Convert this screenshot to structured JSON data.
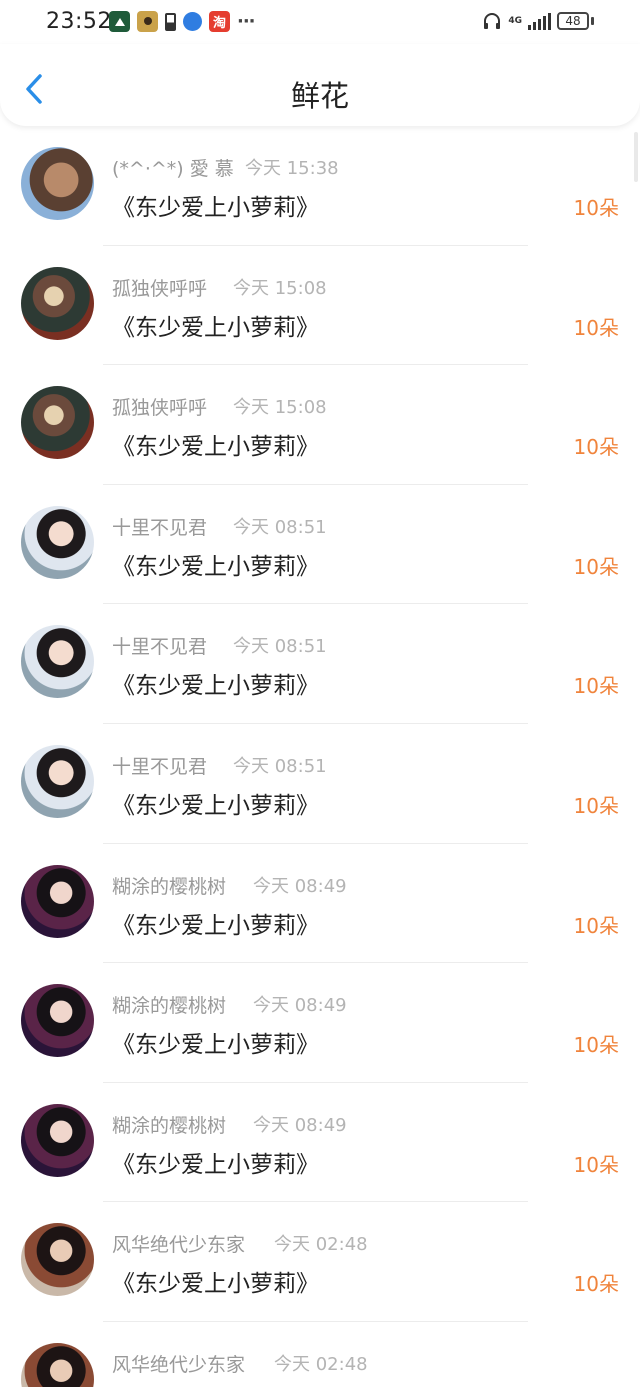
{
  "status_bar": {
    "time": "23:52",
    "notification_icon_labels": [
      "淘"
    ],
    "more": "···",
    "network": "4G",
    "battery": "48"
  },
  "header": {
    "title": "鲜花",
    "accent_color": "#2a8ee8"
  },
  "list": [
    {
      "name": "(*^·^*) 愛 慕",
      "time": "今天 15:38",
      "book": "《东少爱上小萝莉》",
      "count": "10朵"
    },
    {
      "name": "孤独侠呼呼",
      "time": "今天 15:08",
      "book": "《东少爱上小萝莉》",
      "count": "10朵"
    },
    {
      "name": "孤独侠呼呼",
      "time": "今天 15:08",
      "book": "《东少爱上小萝莉》",
      "count": "10朵"
    },
    {
      "name": "十里不见君",
      "time": "今天 08:51",
      "book": "《东少爱上小萝莉》",
      "count": "10朵"
    },
    {
      "name": "十里不见君",
      "time": "今天 08:51",
      "book": "《东少爱上小萝莉》",
      "count": "10朵"
    },
    {
      "name": "十里不见君",
      "time": "今天 08:51",
      "book": "《东少爱上小萝莉》",
      "count": "10朵"
    },
    {
      "name": "糊涂的樱桃树",
      "time": "今天 08:49",
      "book": "《东少爱上小萝莉》",
      "count": "10朵"
    },
    {
      "name": "糊涂的樱桃树",
      "time": "今天 08:49",
      "book": "《东少爱上小萝莉》",
      "count": "10朵"
    },
    {
      "name": "糊涂的樱桃树",
      "time": "今天 08:49",
      "book": "《东少爱上小萝莉》",
      "count": "10朵"
    },
    {
      "name": "风华绝代少东家",
      "time": "今天 02:48",
      "book": "《东少爱上小萝莉》",
      "count": "10朵"
    },
    {
      "name": "风华绝代少东家",
      "time": "今天 02:48",
      "book": "",
      "count": ""
    }
  ],
  "colors": {
    "name_text": "#999999",
    "time_text": "#b4b4b4",
    "book_text": "#222222",
    "count_text": "#f0843c"
  }
}
